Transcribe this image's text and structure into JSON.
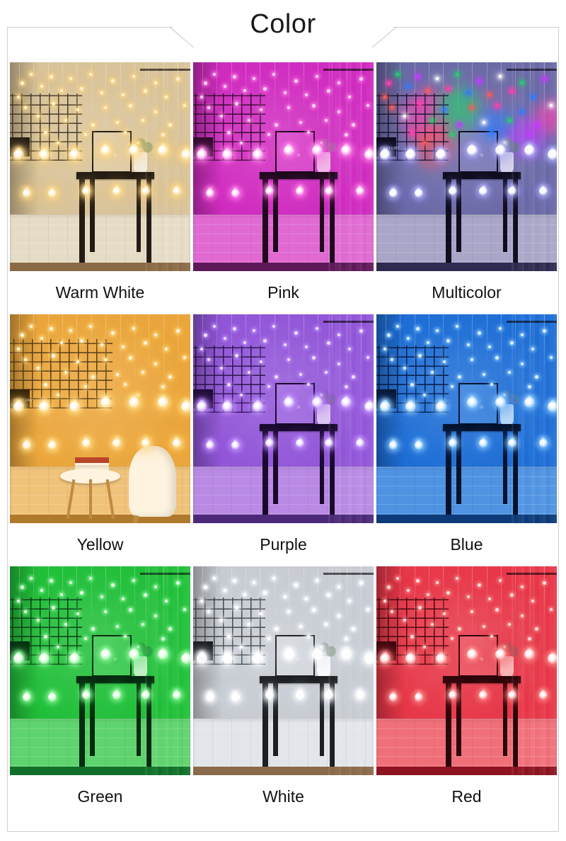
{
  "header": {
    "title": "Color",
    "decoration": "diagonal-line-ornaments"
  },
  "grid": {
    "columns": 3,
    "rows": 3,
    "items": [
      {
        "id": "warm-white",
        "label": "Warm White",
        "scene": "room-console-table",
        "colors": {
          "wall": "#d8c39a",
          "bulb": "#fff3cf",
          "glow": "rgba(255,223,150,0.85)",
          "glow2": "rgba(255,200,90,0.45)",
          "brick": "#e6dcc6",
          "floor": "#8a6a46",
          "mesh": "#3a2f20",
          "table": "#241c14",
          "vase": "#f3ecdd",
          "leaf": "#9aa878",
          "glass": "rgba(255,240,205,0.14)",
          "sign": "#1e1a14"
        }
      },
      {
        "id": "pink",
        "label": "Pink",
        "scene": "room-console-table",
        "colors": {
          "wall": "#cf2cc0",
          "bulb": "#ffd8f6",
          "glow": "rgba(255,140,235,0.85)",
          "glow2": "rgba(230,60,200,0.45)",
          "brick": "#e06ad2",
          "floor": "#5e1a58",
          "mesh": "#2a0c28",
          "table": "#1d0a1c",
          "vase": "#f2b6e6",
          "leaf": "#b463aa",
          "glass": "rgba(255,170,240,0.15)",
          "sign": "#2a0b26"
        }
      },
      {
        "id": "multicolor",
        "label": "Multicolor",
        "scene": "room-console-table-multicolor",
        "colors": {
          "wall": "#6b6aa6",
          "bulb": "#ffffff",
          "glow": "rgba(190,190,255,0.8)",
          "glow2": "rgba(120,110,220,0.45)",
          "brick": "#a9a6c8",
          "floor": "#2e2a50",
          "mesh": "#14122a",
          "table": "#0f0d1e",
          "vase": "#d6d3ea",
          "leaf": "#6d7a8c",
          "glass": "rgba(200,200,255,0.14)",
          "sign": "#0a0918",
          "blobs": [
            "#ff3fb0",
            "#22d06a",
            "#2f7bff",
            "#c23cff",
            "#ff5a5a"
          ]
        },
        "sign_text": "CENTURY"
      },
      {
        "id": "yellow",
        "label": "Yellow",
        "scene": "room-round-table-chair",
        "colors": {
          "wall": "#eaa63c",
          "bulb": "#fff6dc",
          "glow": "rgba(255,226,150,0.9)",
          "glow2": "rgba(255,190,70,0.5)",
          "brick": "#f0c37a",
          "floor": "#b07a2c",
          "mesh": "#4a3416",
          "table": "#3a2712",
          "vase": "#fdf3df",
          "leaf": "#b08a3a",
          "glass": "rgba(255,235,190,0.16)",
          "sign": "#2e2008",
          "wood": "#c08a40",
          "book": "#b8442a"
        },
        "sign_text": "CENTURY"
      },
      {
        "id": "purple",
        "label": "Purple",
        "scene": "room-console-table",
        "colors": {
          "wall": "#9257d8",
          "bulb": "#efe0ff",
          "glow": "rgba(200,160,255,0.85)",
          "glow2": "rgba(150,80,230,0.45)",
          "brick": "#b98ae4",
          "floor": "#4a2a78",
          "mesh": "#241040",
          "table": "#190a2c",
          "vase": "#ddc8f2",
          "leaf": "#8a6ab0",
          "glass": "rgba(220,190,255,0.15)",
          "sign": "#1c0a32"
        }
      },
      {
        "id": "blue",
        "label": "Blue",
        "scene": "room-console-table",
        "colors": {
          "wall": "#1f6fd6",
          "bulb": "#dcefff",
          "glow": "rgba(150,210,255,0.85)",
          "glow2": "rgba(40,120,230,0.5)",
          "brick": "#4f93e2",
          "floor": "#0d3a78",
          "mesh": "#06173a",
          "table": "#05122c",
          "vase": "#b7d8f5",
          "leaf": "#4c7fb8",
          "glass": "rgba(180,220,255,0.15)",
          "sign": "#07152f"
        }
      },
      {
        "id": "green",
        "label": "Green",
        "scene": "room-console-table",
        "colors": {
          "wall": "#22c03a",
          "bulb": "#e6ffe6",
          "glow": "rgba(160,255,170,0.85)",
          "glow2": "rgba(40,200,70,0.5)",
          "brick": "#5fd36e",
          "floor": "#10702a",
          "mesh": "#0a3514",
          "table": "#062a10",
          "vase": "#c4f0c8",
          "leaf": "#2f9a42",
          "glass": "rgba(190,255,195,0.15)",
          "sign": "#062a10"
        }
      },
      {
        "id": "white",
        "label": "White",
        "scene": "room-console-table",
        "colors": {
          "wall": "#c8ccd2",
          "bulb": "#ffffff",
          "glow": "rgba(255,255,255,0.9)",
          "glow2": "rgba(210,220,235,0.5)",
          "brick": "#e2e5e9",
          "floor": "#8a6a48",
          "mesh": "#3a3d42",
          "table": "#1d1f22",
          "vase": "#fbfbfc",
          "leaf": "#9aa69a",
          "glass": "rgba(255,255,255,0.2)",
          "sign": "#17191c"
        }
      },
      {
        "id": "red",
        "label": "Red",
        "scene": "room-console-table",
        "colors": {
          "wall": "#e8384a",
          "bulb": "#ffe0e0",
          "glow": "rgba(255,150,150,0.85)",
          "glow2": "rgba(230,50,60,0.5)",
          "brick": "#f0707a",
          "floor": "#8c1420",
          "mesh": "#3a060c",
          "table": "#2c060a",
          "vase": "#f8b8b8",
          "leaf": "#b8565c",
          "glass": "rgba(255,190,190,0.16)",
          "sign": "#3a060c"
        }
      }
    ]
  }
}
